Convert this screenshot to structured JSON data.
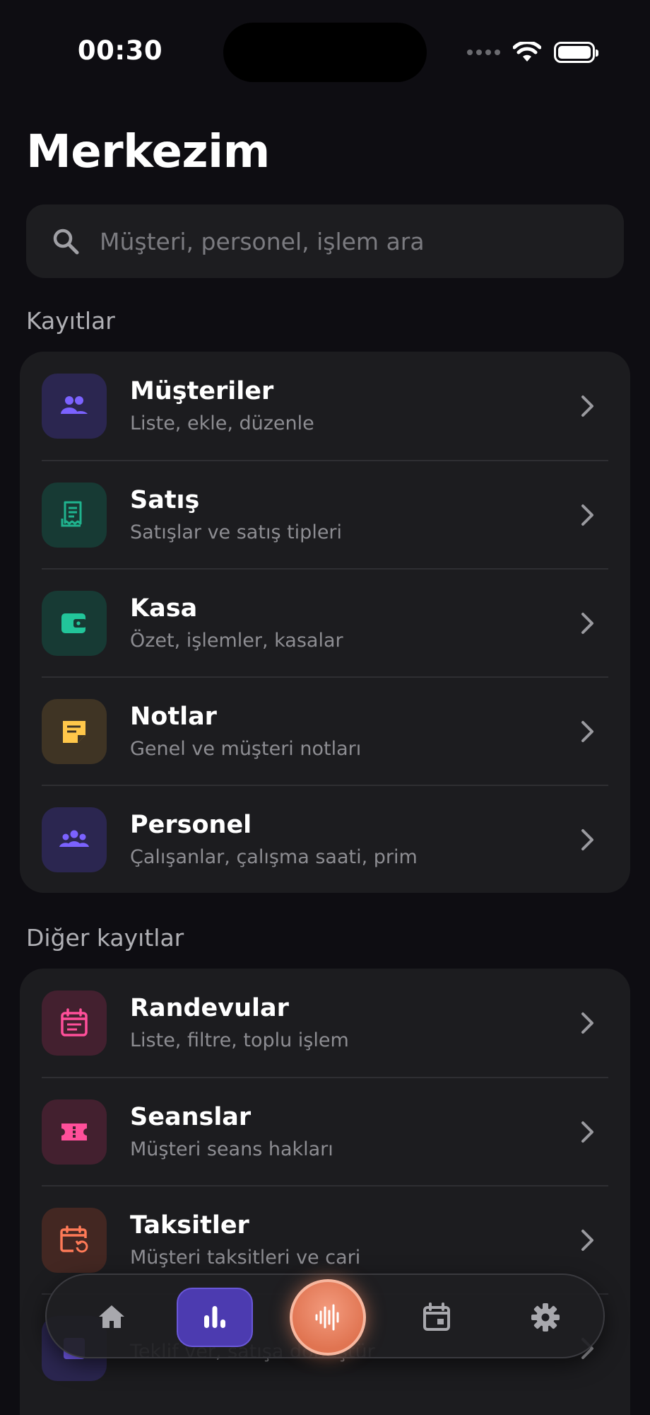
{
  "status_bar": {
    "time": "00:30"
  },
  "header": {
    "title": "Merkezim"
  },
  "search": {
    "placeholder": "Müşteri, personel, işlem ara"
  },
  "sections": [
    {
      "label": "Kayıtlar",
      "items": [
        {
          "title": "Müşteriler",
          "subtitle": "Liste, ekle, düzenle",
          "icon": "customers-icon",
          "color": "#7b62ff"
        },
        {
          "title": "Satış",
          "subtitle": "Satışlar ve satış tipleri",
          "icon": "receipt-icon",
          "color": "#1fb38e"
        },
        {
          "title": "Kasa",
          "subtitle": "Özet, işlemler, kasalar",
          "icon": "wallet-icon",
          "color": "#22c59a"
        },
        {
          "title": "Notlar",
          "subtitle": "Genel ve müşteri notları",
          "icon": "note-icon",
          "color": "#ffc74a"
        },
        {
          "title": "Personel",
          "subtitle": "Çalışanlar, çalışma saati, prim",
          "icon": "staff-icon",
          "color": "#7b62ff"
        }
      ]
    },
    {
      "label": "Diğer kayıtlar",
      "items": [
        {
          "title": "Randevular",
          "subtitle": "Liste, filtre, toplu işlem",
          "icon": "calendar-list-icon",
          "color": "#ff4f9a"
        },
        {
          "title": "Seanslar",
          "subtitle": "Müşteri seans hakları",
          "icon": "ticket-icon",
          "color": "#ff4f9a"
        },
        {
          "title": "Taksitler",
          "subtitle": "Müşteri taksitleri ve cari",
          "icon": "calendar-repeat-icon",
          "color": "#ff7a57"
        },
        {
          "title": "",
          "subtitle": "Teklif ver, satışa dönüştür",
          "icon": "offer-icon",
          "color": "#7b62ff"
        }
      ]
    }
  ],
  "tab_bar": {
    "tabs": [
      "home-icon",
      "stats-icon",
      "voice-icon",
      "calendar-icon",
      "settings-icon"
    ],
    "active": "stats-icon"
  }
}
